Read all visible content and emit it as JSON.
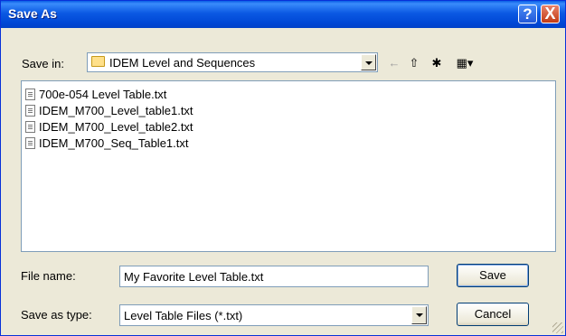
{
  "window": {
    "title": "Save As",
    "help_glyph": "?",
    "close_glyph": "X"
  },
  "save_in": {
    "label": "Save in:",
    "value": "IDEM Level and Sequences",
    "icon": "folder-icon"
  },
  "toolbar": {
    "back_glyph": "←",
    "up_glyph": "⇧",
    "new_folder_glyph": "✱",
    "views_glyph": "▦▾"
  },
  "files": [
    {
      "name": "700e-054  Level Table.txt"
    },
    {
      "name": "IDEM_M700_Level_table1.txt"
    },
    {
      "name": "IDEM_M700_Level_table2.txt"
    },
    {
      "name": "IDEM_M700_Seq_Table1.txt"
    }
  ],
  "file_name": {
    "label": "File name:",
    "value": "My Favorite Level Table.txt"
  },
  "save_as_type": {
    "label": "Save as type:",
    "value": "Level Table Files (*.txt)"
  },
  "buttons": {
    "save": "Save",
    "cancel": "Cancel"
  },
  "colors": {
    "title_bar": "#0054e3",
    "dialog_bg": "#ece9d8",
    "border": "#7f9db9"
  }
}
